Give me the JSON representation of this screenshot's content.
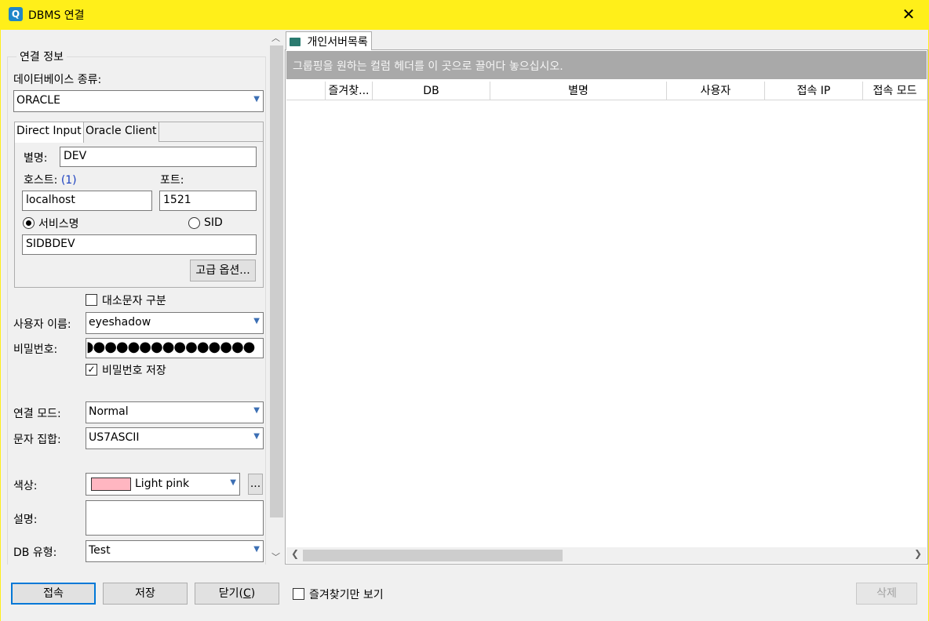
{
  "window": {
    "title": "DBMS 연결",
    "icon": "app-logo-icon",
    "close_glyph": "✕"
  },
  "connection": {
    "group_title": "연결 정보",
    "db_type_label": "데이터베이스 종류:",
    "db_type_value": "ORACLE",
    "tabs": [
      "Direct Input",
      "Oracle Client"
    ],
    "alias_label": "별명:",
    "alias_value": "DEV",
    "host_label": "호스트:",
    "host_hint": "(1)",
    "host_value": "localhost",
    "port_label": "포트:",
    "port_value": "1521",
    "service_name_label": "서비스명",
    "sid_label": "SID",
    "service_value": "SIDBDEV",
    "advanced_button": "고급 옵션...",
    "case_sensitive_label": "대소문자 구분",
    "username_label": "사용자 이름:",
    "username_value": "eyeshadow",
    "password_label": "비밀번호:",
    "password_mask": "◗●●●●●●●●●●●●●●",
    "save_password_label": "비밀번호 저장",
    "mode_label": "연결 모드:",
    "mode_value": "Normal",
    "charset_label": "문자 집합:",
    "charset_value": "US7ASCII",
    "color_label": "색상:",
    "color_value": "Light pink",
    "color_hex": "#ffb6c1",
    "more_button": "...",
    "description_label": "설명:",
    "description_value": "",
    "db_kind_label": "DB 유형:",
    "db_kind_value": "Test"
  },
  "server_list": {
    "tab_label": "개인서버목록",
    "group_hint": "그룹핑을 원하는 컬럼 헤더를 이 곳으로 끌어다 놓으십시오.",
    "columns": [
      "",
      "즐겨찾...",
      "DB",
      "별명",
      "사용자",
      "접속 IP",
      "접속 모드"
    ]
  },
  "footer": {
    "connect": "접속",
    "save": "저장",
    "close": "닫기(",
    "close_mnemonic": "C",
    "close_suffix": ")",
    "favorites_only": "즐겨찾기만 보기",
    "delete": "삭제"
  },
  "colors": {
    "titlebar": "#ffef1a",
    "frame": "#f0f0f0",
    "group_bar": "#a9a9a9"
  }
}
